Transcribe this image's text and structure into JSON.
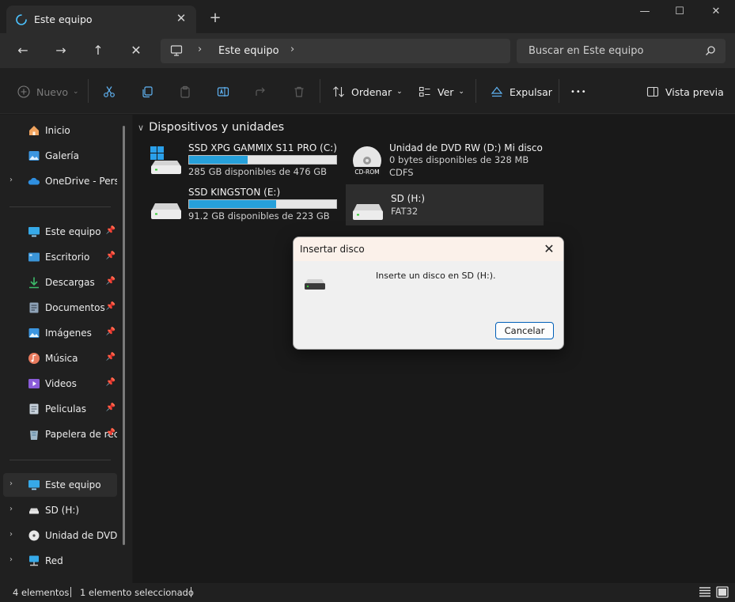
{
  "window": {
    "tab_title": "Este equipo",
    "new_tab": "+",
    "minimize": "—",
    "maximize": "☐",
    "close": "✕",
    "tab_close": "✕"
  },
  "nav": {
    "back": "←",
    "forward": "→",
    "up": "↑",
    "stop": "✕",
    "breadcrumb": "Este equipo",
    "chevron": "›",
    "search_placeholder": "Buscar en Este equipo"
  },
  "toolbar": {
    "new_label": "Nuevo",
    "sort_label": "Ordenar",
    "view_label": "Ver",
    "eject_label": "Expulsar",
    "more": "•••",
    "preview_label": "Vista previa"
  },
  "sidebar": {
    "quick": [
      {
        "label": "Inicio"
      },
      {
        "label": "Galería"
      },
      {
        "label": "OneDrive - Personal"
      }
    ],
    "pinned": [
      {
        "label": "Este equipo"
      },
      {
        "label": "Escritorio"
      },
      {
        "label": "Descargas"
      },
      {
        "label": "Documentos"
      },
      {
        "label": "Imágenes"
      },
      {
        "label": "Música"
      },
      {
        "label": "Videos"
      },
      {
        "label": "Peliculas"
      },
      {
        "label": "Papelera de reciclaje"
      }
    ],
    "tree": [
      {
        "label": "Este equipo"
      },
      {
        "label": "SD (H:)"
      },
      {
        "label": "Unidad de DVD RW (D:) Mi disco"
      },
      {
        "label": "Red"
      }
    ]
  },
  "content": {
    "group_title": "Dispositivos y unidades",
    "drives": [
      {
        "name": "SSD XPG GAMMIX S11 PRO (C:)",
        "info": "285 GB disponibles de 476 GB",
        "used_fraction": 0.4
      },
      {
        "name": "Unidad de DVD RW (D:) Mi disco",
        "line2": "0 bytes disponibles de 328 MB",
        "line3": "CDFS",
        "icon_text": "CD-ROM"
      },
      {
        "name": "SSD KINGSTON (E:)",
        "info": "91.2 GB disponibles de 223 GB",
        "used_fraction": 0.59
      },
      {
        "name": "SD (H:)",
        "line2": "FAT32"
      }
    ]
  },
  "status": {
    "count": "4 elementos",
    "selected": "1 elemento seleccionado"
  },
  "dialog": {
    "title": "Insertar disco",
    "message": "Inserte un disco en SD (H:).",
    "cancel": "Cancelar",
    "close": "✕"
  }
}
